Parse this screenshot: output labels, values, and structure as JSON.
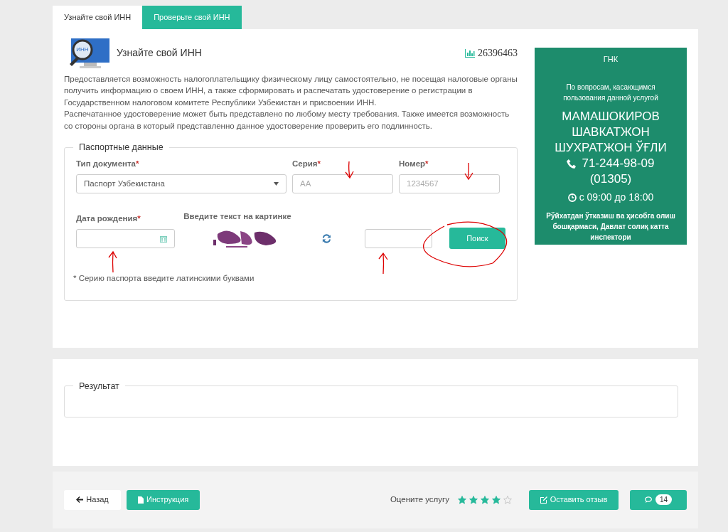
{
  "tabs": [
    {
      "label": "Узнайте свой ИНН",
      "selected": true
    },
    {
      "label": "Проверьте свой ИНН",
      "selected": false
    }
  ],
  "service": {
    "logo_text": "ИНН",
    "title": "Узнайте свой ИНН",
    "counter": "26396463",
    "paragraphs": [
      "Предоставляется возможность налогоплательщику физическому лицу самостоятельно, не посещая налоговые органы получить информацию о своем ИНН, а также сформировать и распечатать удостоверение о регистрации в Государственном налоговом комитете Республики Узбекистан и присвоении ИНН.",
      "Распечатанное удостоверение может быть представлено по любому месту требования. Также имеется возможность со стороны органа в который представленно данное удостоверение проверить его подлинность."
    ]
  },
  "passport": {
    "legend": "Паспортные данные",
    "document_type": {
      "label": "Тип документа",
      "required_mark": "*",
      "value": "Паспорт Узбекистана"
    },
    "series": {
      "label": "Серия",
      "required_mark": "*",
      "placeholder": "AA"
    },
    "number": {
      "label": "Номер",
      "required_mark": "*",
      "placeholder": "1234567"
    },
    "birth_date": {
      "label": "Дата рождения",
      "required_mark": "*"
    },
    "captcha": {
      "label": "Введите текст на картинке",
      "kind": "picture"
    },
    "search_button": "Поиск",
    "note": "* Серию паспорта введите латинскими буквами"
  },
  "contact": {
    "org": "ГНК",
    "intro": "По вопросам, касающимся пользования данной услугой",
    "name": "МАМАШОКИРОВ ШАВКАТЖОН ШУХРАТЖОН ЎҒЛИ",
    "phone": "71-244-98-09",
    "extension": "(01305)",
    "hours": "с 09:00 до 18:00",
    "department": "Рўйхатдан ўтказиш ва ҳисобга олиш бошқармаси, Давлат солиқ катта инспектори"
  },
  "result": {
    "legend": "Результат"
  },
  "footer": {
    "back_button": "Назад",
    "instruction_button": "Инструкция",
    "rating_label": "Оцените услугу",
    "stars": 4,
    "feedback_button": "Оставить отзыв",
    "comments_count": "14"
  }
}
